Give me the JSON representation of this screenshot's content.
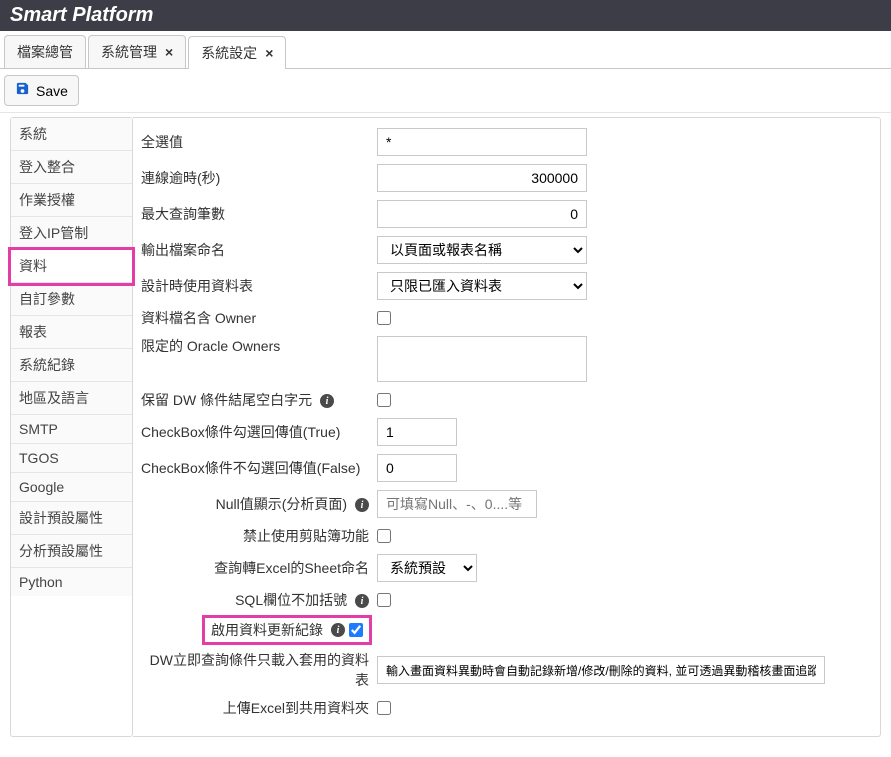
{
  "header": {
    "title": "Smart Platform"
  },
  "tabs": [
    {
      "label": "檔案總管",
      "closable": false
    },
    {
      "label": "系統管理",
      "closable": true
    },
    {
      "label": "系統設定",
      "closable": true,
      "active": true
    }
  ],
  "toolbar": {
    "save_label": "Save"
  },
  "sidebar": {
    "items": [
      {
        "label": "系統"
      },
      {
        "label": "登入整合"
      },
      {
        "label": "作業授權"
      },
      {
        "label": "登入IP管制"
      },
      {
        "label": "資料",
        "selected": true
      },
      {
        "label": "自訂參數"
      },
      {
        "label": "報表"
      },
      {
        "label": "系統紀錄"
      },
      {
        "label": "地區及語言"
      },
      {
        "label": "SMTP"
      },
      {
        "label": "TGOS"
      },
      {
        "label": "Google"
      },
      {
        "label": "設計預設屬性"
      },
      {
        "label": "分析預設屬性"
      },
      {
        "label": "Python"
      }
    ]
  },
  "form": {
    "all_value_label": "全選值",
    "all_value": "*",
    "conn_timeout_label": "連線逾時(秒)",
    "conn_timeout": "300000",
    "max_query_label": "最大查詢筆數",
    "max_query": "0",
    "output_file_label": "輸出檔案命名",
    "output_file_option": "以頁面或報表名稱",
    "design_table_label": "設計時使用資料表",
    "design_table_option": "只限已匯入資料表",
    "owner_label": "資料檔名含 Owner",
    "oracle_owners_label": "限定的 Oracle Owners",
    "keep_dw_label": "保留 DW 條件結尾空白字元",
    "cb_true_label": "CheckBox條件勾選回傳值(True)",
    "cb_true": "1",
    "cb_false_label": "CheckBox條件不勾選回傳值(False)",
    "cb_false": "0",
    "null_display_label": "Null值顯示(分析頁面)",
    "null_display_placeholder": "可填寫Null、-、0....等",
    "disable_clipboard_label": "禁止使用剪貼簿功能",
    "excel_sheet_label": "查詢轉Excel的Sheet命名",
    "excel_sheet_option": "系統預設",
    "sql_no_bracket_label": "SQL欄位不加括號",
    "enable_update_log_label": "啟用資料更新紀錄",
    "dw_load_label": "DW立即查詢條件只載入套用的資料表",
    "dw_load_value": "輸入畫面資料異動時會自動記錄新增/修改/刪除的資料, 並可透過異動稽核畫面追蹤",
    "upload_excel_label": "上傳Excel到共用資料夾"
  }
}
